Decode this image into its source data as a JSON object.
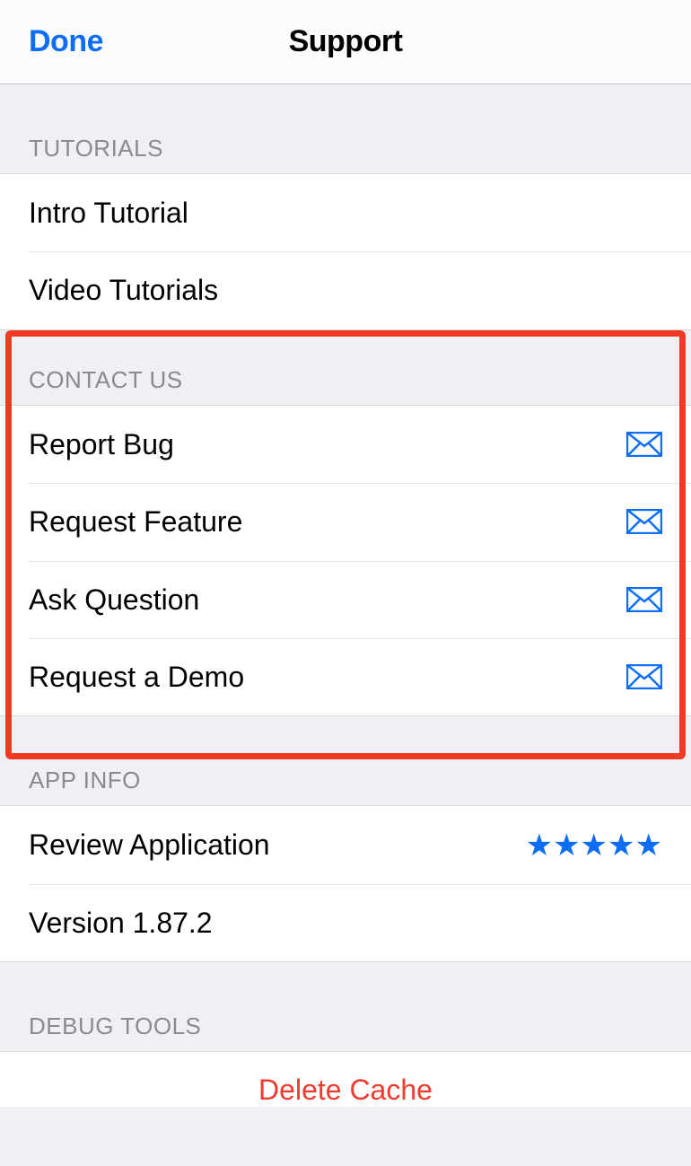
{
  "nav": {
    "done": "Done",
    "title": "Support"
  },
  "sections": {
    "tutorials": {
      "header": "TUTORIALS",
      "intro": "Intro Tutorial",
      "video": "Video Tutorials"
    },
    "contact": {
      "header": "CONTACT US",
      "report_bug": "Report Bug",
      "request_feature": "Request Feature",
      "ask_question": "Ask Question",
      "request_demo": "Request a Demo"
    },
    "app_info": {
      "header": "APP INFO",
      "review": "Review Application",
      "version": "Version 1.87.2"
    },
    "debug": {
      "header": "DEBUG TOOLS",
      "delete_cache": "Delete Cache"
    }
  },
  "colors": {
    "accent": "#0d6df6",
    "destructive": "#ed3b30",
    "highlight": "#f13a24"
  }
}
